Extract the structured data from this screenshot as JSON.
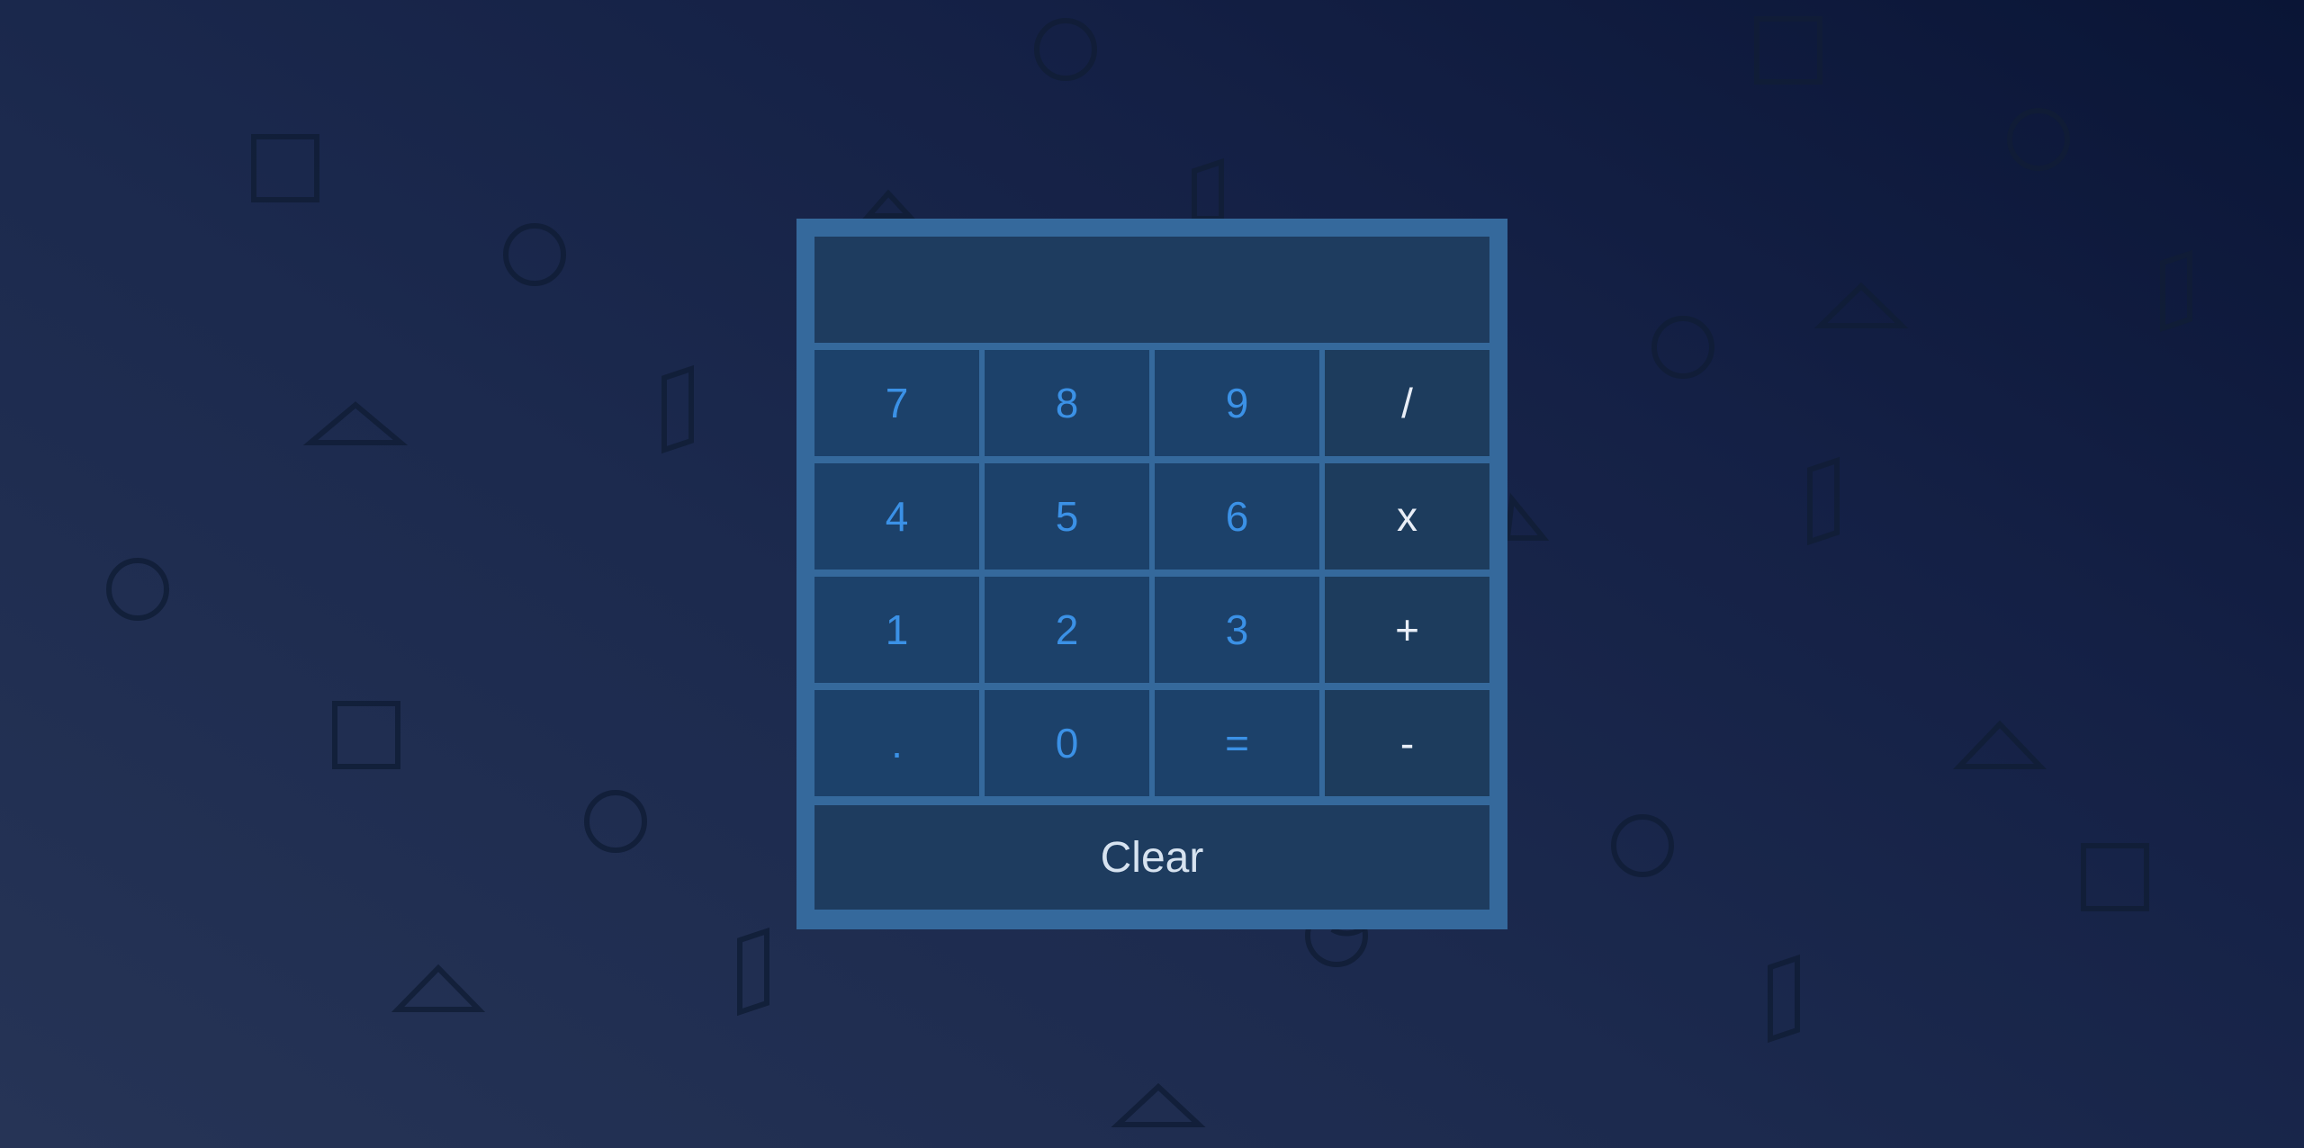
{
  "display": {
    "value": ""
  },
  "keys": [
    {
      "label": "7",
      "type": "digit",
      "name": "key-7"
    },
    {
      "label": "8",
      "type": "digit",
      "name": "key-8"
    },
    {
      "label": "9",
      "type": "digit",
      "name": "key-9"
    },
    {
      "label": "/",
      "type": "operator",
      "name": "divide-button"
    },
    {
      "label": "4",
      "type": "digit",
      "name": "key-4"
    },
    {
      "label": "5",
      "type": "digit",
      "name": "key-5"
    },
    {
      "label": "6",
      "type": "digit",
      "name": "key-6"
    },
    {
      "label": "x",
      "type": "operator",
      "name": "multiply-button"
    },
    {
      "label": "1",
      "type": "digit",
      "name": "key-1"
    },
    {
      "label": "2",
      "type": "digit",
      "name": "key-2"
    },
    {
      "label": "3",
      "type": "digit",
      "name": "key-3"
    },
    {
      "label": "+",
      "type": "operator",
      "name": "add-button"
    },
    {
      "label": ".",
      "type": "digit",
      "name": "decimal-button"
    },
    {
      "label": "0",
      "type": "digit",
      "name": "key-0"
    },
    {
      "label": "=",
      "type": "digit",
      "name": "equals-button"
    },
    {
      "label": "-",
      "type": "operator",
      "name": "subtract-button"
    }
  ],
  "clear_label": "Clear",
  "colors": {
    "calculator_frame": "#35699c",
    "digit_key_bg": "#1c416a",
    "digit_key_text": "#3b91e6",
    "operator_key_bg": "#1d3c5d",
    "operator_key_text": "#e8eef7"
  }
}
